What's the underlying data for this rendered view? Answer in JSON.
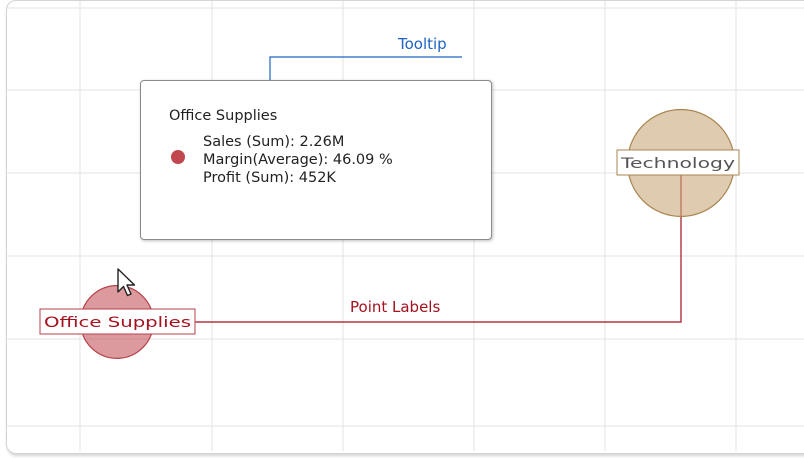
{
  "chart_data": {
    "type": "bubble",
    "grid": true,
    "points": [
      {
        "label": "Office Supplies",
        "color": "#c1474e",
        "stroke": "#b4424a",
        "size": 0.68
      },
      {
        "label": "Technology",
        "color": "#c9a97a",
        "stroke": "#a8844f",
        "size": 1.0
      }
    ]
  },
  "tooltip": {
    "title": "Office Supplies",
    "rows": [
      "Sales (Sum): 2.26M",
      "Margin(Average): 46.09 %",
      "Profit (Sum): 452K"
    ],
    "marker_color": "#c1474e"
  },
  "annotations": {
    "tooltip_label": "Tooltip",
    "tooltip_color": "#1e63c4",
    "point_labels_label": "Point Labels",
    "point_labels_color": "#a3121e"
  }
}
